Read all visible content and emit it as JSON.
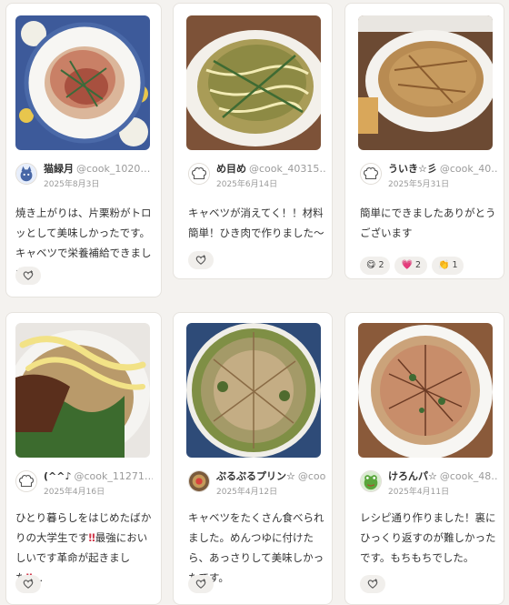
{
  "cards": [
    {
      "nickname": "猫緑月",
      "user_id": "@cook_1020…",
      "date": "2025年8月3日",
      "comment": "焼き上がりは、片栗粉がトロッとして美味しかったです。キャベツで栄養補給できました。",
      "avatar": "cat-avatar-icon",
      "react_icon": "heart-plus-icon"
    },
    {
      "nickname": "め目め",
      "user_id": "@cook_40315…",
      "date": "2025年6月14日",
      "comment": "キャベツが消えてく！！材料簡単！ひき肉で作りました〜",
      "avatar": "chef-hat-avatar-icon",
      "react_icon": "heart-plus-icon"
    },
    {
      "nickname": "ういき☆彡",
      "user_id": "@cook_40…",
      "date": "2025年5月31日",
      "comment": "簡単にできましたありがとうございます",
      "avatar": "chef-hat-avatar-icon",
      "reactions": [
        {
          "emoji": "😋",
          "count": "2"
        },
        {
          "emoji": "💗",
          "count": "2"
        },
        {
          "emoji": "👏",
          "count": "1"
        }
      ]
    },
    {
      "nickname": "(^^♪",
      "user_id": "@cook_11271…",
      "date": "2025年4月16日",
      "comment_part1": "ひとり暮らしをはじめたばかりの大学生です",
      "mark1": "‼",
      "comment_part2": "最強においしいです革命が起きました",
      "mark2": "‼",
      "comment_part3": "…",
      "avatar": "chef-hat-avatar-icon",
      "react_icon": "heart-plus-icon"
    },
    {
      "nickname": "ぷるぷるプリン☆",
      "user_id": "@coo…",
      "date": "2025年4月12日",
      "comment": "キャベツをたくさん食べられました。めんつゆに付けたら、あっさりして美味しかったです。",
      "avatar": "photo-avatar-icon",
      "react_icon": "heart-plus-icon"
    },
    {
      "nickname": "けろんパ☆",
      "user_id": "@cook_48…",
      "date": "2025年4月11日",
      "comment": "レシピ通り作りました！裏にひっくり返すのが難しかったです。もちもちでした。",
      "avatar": "frog-avatar-icon",
      "react_icon": "heart-plus-icon"
    }
  ]
}
